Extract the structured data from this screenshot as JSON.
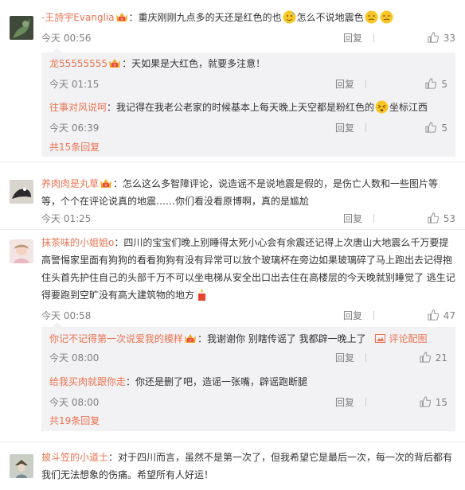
{
  "comments": [
    {
      "user": "-王詩宇Evanglia",
      "text_a": "：重庆刚刚九点多的天还是红色的也",
      "text_b": "怎么不说地震色",
      "time": "今天 00:56",
      "reply": "回复",
      "likes": "33",
      "subs": [
        {
          "user": "龙55555555",
          "text": "：天如果是大红色，就要多注意！",
          "time": "今天 01:15",
          "reply": "回复",
          "likes": "5"
        },
        {
          "user": "往事对风说呵",
          "text_a": "：我记得在我老公老家的时候基本上每天晚上天空都是粉红色的",
          "text_b": "坐标江西",
          "time": "今天 06:39",
          "reply": "回复",
          "likes": "5"
        }
      ],
      "more": "共15条回复"
    },
    {
      "user": "养肉肉是丸草",
      "text": "：怎么这么多智障评论，说造谣不是说地震是假的，是伤亡人数和一些图片等等，个个在评论说真的地震……你们看没看原博啊，真的是尴尬",
      "time": "今天 01:25",
      "reply": "回复",
      "likes": "53"
    },
    {
      "user": "抹茶味的小姐姐o",
      "text": "：四川的宝宝们晚上别睡得太死小心会有余震还记得上次唐山大地震么千万要提高警惕家里面有狗狗的看看狗狗有没有异常可以放个玻璃杯在旁边如果玻璃碎了马上跑出去记得抱住头首先护住自己的头部千万不可以坐电梯从安全出口出去住在高楼层的今天晚就别睡觉了 逃生记得要跑到空旷没有高大建筑物的地方",
      "time": "今天 00:58",
      "reply": "回复",
      "likes": "47",
      "subs": [
        {
          "user": "你记不记得第一次说爱我的模样",
          "text": "：我谢谢你 别瞎传谣了 我都辟一晚上了",
          "pic": "评论配图",
          "time": "今天 08:00",
          "reply": "回复",
          "likes": "21"
        },
        {
          "user": "给我买肉就跟你走",
          "text": "：你还是删了吧，造谣一张嘴，辟谣跑断腿",
          "time": "今天 08:00",
          "reply": "回复",
          "likes": "15"
        }
      ],
      "more": "共19条回复"
    },
    {
      "user": "披斗笠的小道士",
      "text": "：对于四川而言，虽然不是第一次了，但我希望它是最后一次，每一次的背后都有我们无法想象的伤痛。希望所有人好运！"
    }
  ]
}
